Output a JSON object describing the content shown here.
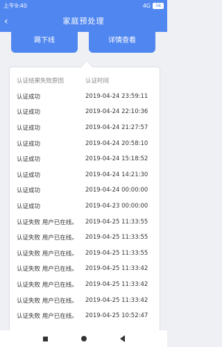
{
  "status": {
    "time": "上午9:40",
    "network": "4G",
    "battery": "58"
  },
  "nav": {
    "title": "家庭预处理",
    "back_icon": "chevron-left-icon"
  },
  "buttons": {
    "left_label": "踢下线",
    "right_label": "详情查看"
  },
  "table": {
    "headers": [
      "认证结果失败原因",
      "认证时间"
    ],
    "rows": [
      {
        "result": "认证成功",
        "time": "2019-04-24 23:59:11"
      },
      {
        "result": "认证成功",
        "time": "2019-04-24 22:10:36"
      },
      {
        "result": "认证成功",
        "time": "2019-04-24 21:27:57"
      },
      {
        "result": "认证成功",
        "time": "2019-04-24 20:58:10"
      },
      {
        "result": "认证成功",
        "time": "2019-04-24 15:18:52"
      },
      {
        "result": "认证成功",
        "time": "2019-04-24 14:21:30"
      },
      {
        "result": "认证成功",
        "time": "2019-04-24 00:00:00"
      },
      {
        "result": "认证成功",
        "time": "2019-04-23 00:00:00"
      },
      {
        "result": "认证失败 用户已在线。",
        "time": "2019-04-25 11:33:55"
      },
      {
        "result": "认证失败 用户已在线。",
        "time": "2019-04-25 11:33:55"
      },
      {
        "result": "认证失败 用户已在线。",
        "time": "2019-04-25 11:33:55"
      },
      {
        "result": "认证失败 用户已在线。",
        "time": "2019-04-25 11:33:42"
      },
      {
        "result": "认证失败 用户已在线。",
        "time": "2019-04-25 11:33:42"
      },
      {
        "result": "认证失败 用户已在线。",
        "time": "2019-04-25 11:33:42"
      },
      {
        "result": "认证失败 用户已在线。",
        "time": "2019-04-25 10:52:47"
      }
    ]
  },
  "system_nav": {
    "icons": [
      "recent-apps-icon",
      "home-icon",
      "back-icon"
    ]
  }
}
